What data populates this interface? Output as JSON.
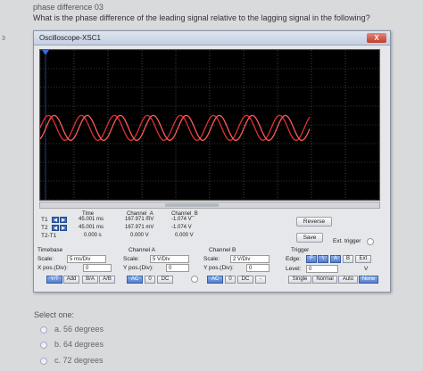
{
  "quiz": {
    "title": "phase difference 03",
    "question": "What is the phase difference of the leading signal relative to the lagging signal in the following?",
    "side_number": "3",
    "select_prompt": "Select one:",
    "options": [
      {
        "label": "a. 56 degrees"
      },
      {
        "label": "b. 64 degrees"
      },
      {
        "label": "c. 72 degrees"
      }
    ]
  },
  "window": {
    "title": "Oscilloscope-XSC1",
    "close_label": "X"
  },
  "colors": {
    "trace_a": "#e03030",
    "trace_b": "#ff5a5a",
    "grid": "#6a6a6a",
    "cursor": "#3a6ad8"
  },
  "readout": {
    "headers": {
      "time": "Time",
      "channel_a": "Channel_A",
      "channel_b": "Channel_B"
    },
    "rows": [
      {
        "label": "T1",
        "time": "45.001 ms",
        "a": "167.971 mV",
        "b": "-1.074 V"
      },
      {
        "label": "T2",
        "time": "45.001 ms",
        "a": "167.971 mV",
        "b": "-1.074 V"
      },
      {
        "label": "T2-T1",
        "time": "0.000 s",
        "a": "0.000 V",
        "b": "0.000 V"
      }
    ]
  },
  "buttons": {
    "reverse": "Reverse",
    "save": "Save",
    "ext_trigger": "Ext. trigger"
  },
  "timebase": {
    "title": "Timebase",
    "scale_label": "Scale:",
    "scale_value": "5 ms/Div",
    "xpos_label": "X pos.(Div):",
    "xpos_value": "0",
    "modes": [
      "Y/T",
      "Add",
      "B/A",
      "A/B"
    ]
  },
  "channel_a": {
    "title": "Channel A",
    "scale_label": "Scale:",
    "scale_value": "5 V/Div",
    "ypos_label": "Y pos.(Div):",
    "ypos_value": "0",
    "coupling": [
      "AC",
      "0",
      "DC"
    ]
  },
  "channel_b": {
    "title": "Channel B",
    "scale_label": "Scale:",
    "scale_value": "2 V/Div",
    "ypos_label": "Y pos.(Div):",
    "ypos_value": "0",
    "coupling": [
      "AC",
      "0",
      "DC",
      "-"
    ]
  },
  "trigger": {
    "title": "Trigger",
    "edge_label": "Edge:",
    "edge_options": [
      "F",
      "\\",
      "A",
      "B",
      "Ext"
    ],
    "level_label": "Level:",
    "level_value": "0",
    "level_unit": "V",
    "modes": [
      "Single",
      "Normal",
      "Auto",
      "None"
    ]
  }
}
